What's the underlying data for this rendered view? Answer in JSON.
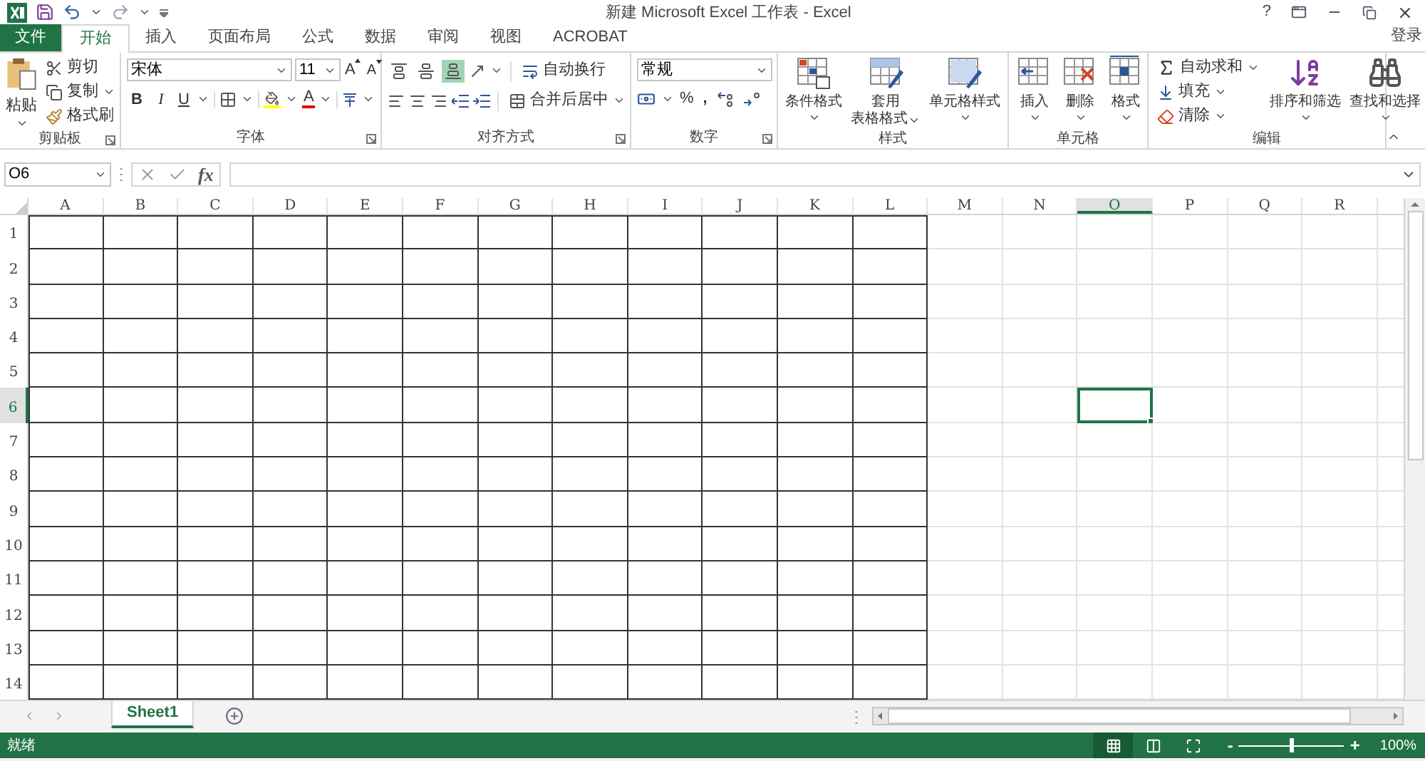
{
  "window": {
    "title": "新建 Microsoft Excel 工作表 - Excel",
    "help": "?",
    "sign_in": "登录"
  },
  "ribbon_tabs": [
    {
      "label": "文件",
      "kind": "file",
      "selected": false
    },
    {
      "label": "开始",
      "kind": "tab",
      "selected": true
    },
    {
      "label": "插入",
      "kind": "tab",
      "selected": false
    },
    {
      "label": "页面布局",
      "kind": "tab",
      "selected": false
    },
    {
      "label": "公式",
      "kind": "tab",
      "selected": false
    },
    {
      "label": "数据",
      "kind": "tab",
      "selected": false
    },
    {
      "label": "审阅",
      "kind": "tab",
      "selected": false
    },
    {
      "label": "视图",
      "kind": "tab",
      "selected": false
    },
    {
      "label": "ACROBAT",
      "kind": "tab",
      "selected": false
    }
  ],
  "clipboard": {
    "label": "剪贴板",
    "paste": "粘贴",
    "cut": "剪切",
    "copy": "复制",
    "format_painter": "格式刷"
  },
  "font": {
    "label": "字体",
    "font_name": "宋体",
    "font_size": "11",
    "grow": "A",
    "shrink": "A",
    "bold": "B",
    "italic": "I",
    "underline": "U",
    "font_color": "A"
  },
  "alignment": {
    "label": "对齐方式",
    "vertical": [
      {
        "selected": false
      },
      {
        "selected": false
      },
      {
        "selected": true
      }
    ],
    "wrap_text": "自动换行",
    "merge_center": "合并后居中"
  },
  "number": {
    "label": "数字",
    "format": "常规",
    "percent": "%",
    "comma": ","
  },
  "styles": {
    "label": "样式",
    "buttons": [
      {
        "lines": [
          "条件格式"
        ]
      },
      {
        "lines": [
          "套用",
          "表格格式"
        ]
      },
      {
        "lines": [
          "单元格样式"
        ]
      }
    ]
  },
  "cells": {
    "label": "单元格",
    "buttons": [
      "插入",
      "删除",
      "格式"
    ]
  },
  "editing": {
    "label": "编辑",
    "autosum": "自动求和",
    "fill": "填充",
    "clear": "清除",
    "sort_filter": "排序和筛选",
    "find_select": "查找和选择"
  },
  "formula_bar": {
    "name_box": "O6",
    "fx": "fx"
  },
  "columns": [
    {
      "label": "A",
      "bordered": true,
      "selected": false
    },
    {
      "label": "B",
      "bordered": true,
      "selected": false
    },
    {
      "label": "C",
      "bordered": true,
      "selected": false
    },
    {
      "label": "D",
      "bordered": true,
      "selected": false
    },
    {
      "label": "E",
      "bordered": true,
      "selected": false
    },
    {
      "label": "F",
      "bordered": true,
      "selected": false
    },
    {
      "label": "G",
      "bordered": true,
      "selected": false
    },
    {
      "label": "H",
      "bordered": true,
      "selected": false
    },
    {
      "label": "I",
      "bordered": true,
      "selected": false
    },
    {
      "label": "J",
      "bordered": true,
      "selected": false
    },
    {
      "label": "K",
      "bordered": true,
      "selected": false
    },
    {
      "label": "L",
      "bordered": true,
      "selected": false
    },
    {
      "label": "M",
      "bordered": false,
      "selected": false
    },
    {
      "label": "N",
      "bordered": false,
      "selected": false
    },
    {
      "label": "O",
      "bordered": false,
      "selected": true
    },
    {
      "label": "P",
      "bordered": false,
      "selected": false
    },
    {
      "label": "Q",
      "bordered": false,
      "selected": false
    },
    {
      "label": "R",
      "bordered": false,
      "selected": false
    }
  ],
  "rows": [
    {
      "label": "1",
      "selected": false
    },
    {
      "label": "2",
      "selected": false
    },
    {
      "label": "3",
      "selected": false
    },
    {
      "label": "4",
      "selected": false
    },
    {
      "label": "5",
      "selected": false
    },
    {
      "label": "6",
      "selected": true
    },
    {
      "label": "7",
      "selected": false
    },
    {
      "label": "8",
      "selected": false
    },
    {
      "label": "9",
      "selected": false
    },
    {
      "label": "10",
      "selected": false
    },
    {
      "label": "11",
      "selected": false
    },
    {
      "label": "12",
      "selected": false
    },
    {
      "label": "13",
      "selected": false
    },
    {
      "label": "14",
      "selected": false
    }
  ],
  "sheet_tabs": [
    {
      "label": "Sheet1",
      "selected": true
    }
  ],
  "status_bar": {
    "status": "就绪",
    "views": [
      {
        "selected": true
      },
      {
        "selected": false
      },
      {
        "selected": false
      }
    ],
    "zoom_minus": "-",
    "zoom": {
      "level": 0.49
    },
    "zoom_plus": "+",
    "zoom_reading": "100%"
  }
}
